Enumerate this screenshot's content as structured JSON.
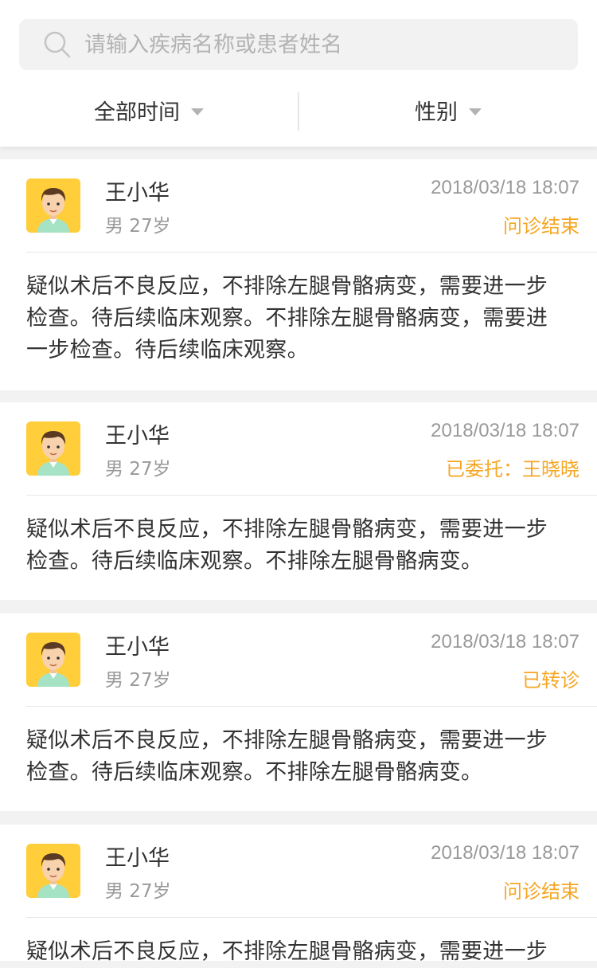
{
  "search": {
    "placeholder": "请输入疾病名称或患者姓名",
    "icon": "search-icon"
  },
  "filters": {
    "time_label": "全部时间",
    "gender_label": "性别"
  },
  "colors": {
    "status": "#f5a623",
    "text": "#333333",
    "muted": "#999999",
    "background": "#f2f2f2",
    "avatar_bg": "#ffce3a"
  },
  "consultations": [
    {
      "name": "王小华",
      "gender_age": "男  27岁",
      "time": "2018/03/18 18:07",
      "status": "问诊结束",
      "description": "疑似术后不良反应，不排除左腿骨骼病变，需要进一步检查。待后续临床观察。不排除左腿骨骼病变，需要进一步检查。待后续临床观察。"
    },
    {
      "name": "王小华",
      "gender_age": "男  27岁",
      "time": "2018/03/18 18:07",
      "status": "已委托：王晓晓",
      "description": "疑似术后不良反应，不排除左腿骨骼病变，需要进一步检查。待后续临床观察。不排除左腿骨骼病变。"
    },
    {
      "name": "王小华",
      "gender_age": "男  27岁",
      "time": "2018/03/18 18:07",
      "status": "已转诊",
      "description": "疑似术后不良反应，不排除左腿骨骼病变，需要进一步检查。待后续临床观察。不排除左腿骨骼病变。"
    },
    {
      "name": "王小华",
      "gender_age": "男  27岁",
      "time": "2018/03/18 18:07",
      "status": "问诊结束",
      "description": "疑似术后不良反应，不排除左腿骨骼病变，需要进一步"
    }
  ]
}
